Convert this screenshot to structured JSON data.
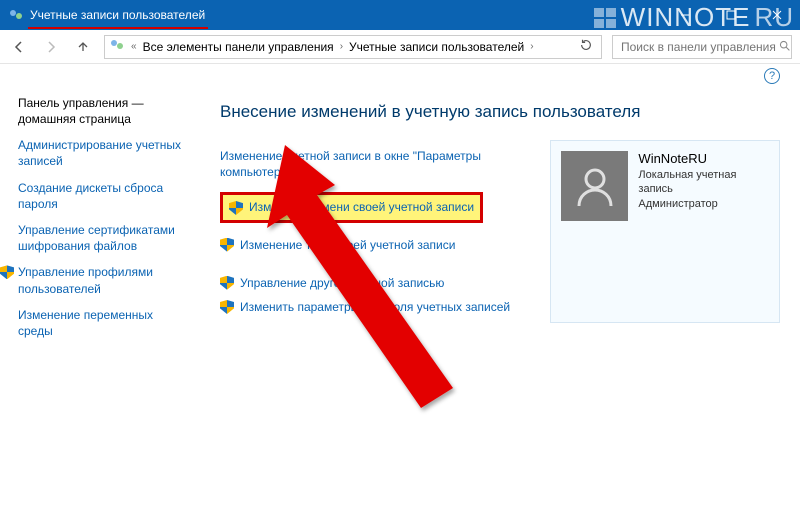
{
  "titlebar": {
    "title": "Учетные записи пользователей"
  },
  "breadcrumb": {
    "root_glyph": "«",
    "items": [
      "Все элементы панели управления",
      "Учетные записи пользователей"
    ]
  },
  "search": {
    "placeholder": "Поиск в панели управления"
  },
  "sidebar": {
    "heading": "Панель управления — домашняя страница",
    "links": [
      {
        "label": "Администрирование учетных записей",
        "shield": false
      },
      {
        "label": "Создание дискеты сброса пароля",
        "shield": false
      },
      {
        "label": "Управление сертификатами шифрования файлов",
        "shield": false
      },
      {
        "label": "Управление профилями пользователей",
        "shield": true
      },
      {
        "label": "Изменение переменных среды",
        "shield": false
      }
    ]
  },
  "content": {
    "title": "Внесение изменений в учетную запись пользователя",
    "tasks": [
      {
        "label": "Изменение учетной записи в окне \"Параметры компьютера\"",
        "shield": false,
        "highlight": false
      },
      {
        "label": "Изменение имени своей учетной записи",
        "shield": true,
        "highlight": true
      },
      {
        "label": "Изменение типа своей учетной записи",
        "shield": true,
        "highlight": false
      },
      {
        "label": "Управление другой учетной записью",
        "shield": true,
        "highlight": false
      },
      {
        "label": "Изменить параметры контроля учетных записей",
        "shield": true,
        "highlight": false
      }
    ],
    "account": {
      "name": "WinNoteRU",
      "type": "Локальная учетная запись",
      "role": "Администратор"
    }
  },
  "watermark": {
    "brand": "WINNOTE",
    "suffix": "RU"
  }
}
